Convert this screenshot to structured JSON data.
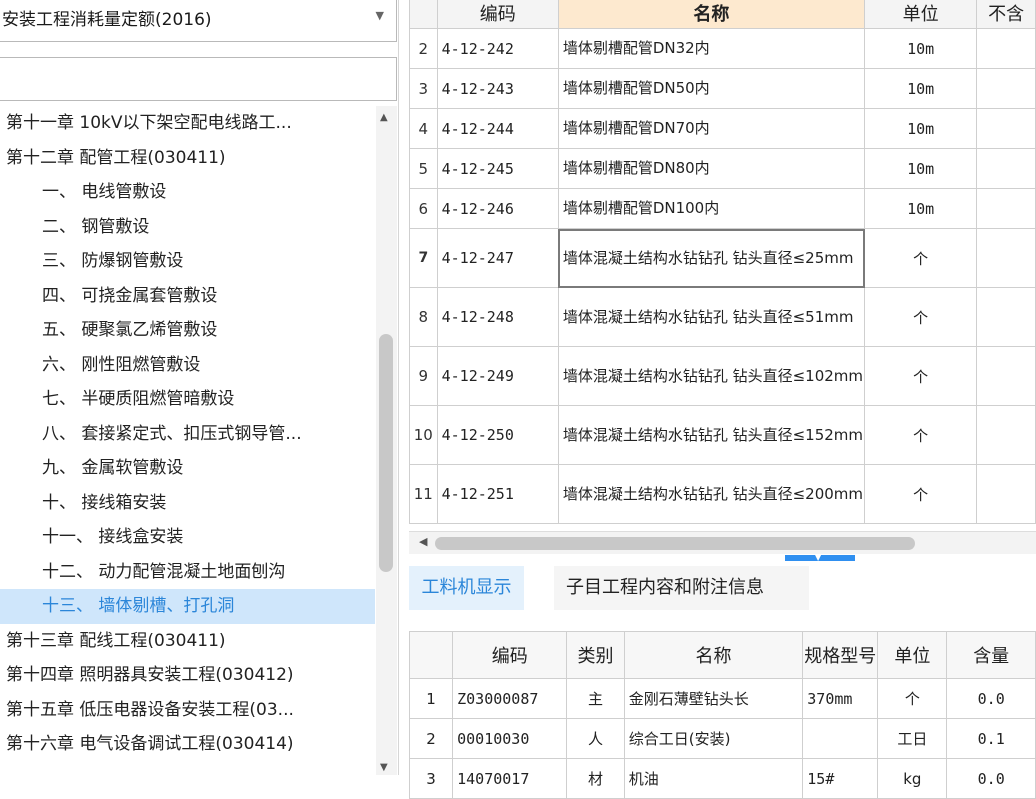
{
  "quota_library": {
    "selected": "安装工程消耗量定额(2016)"
  },
  "search": {
    "value": ""
  },
  "tree": {
    "items": [
      {
        "label": "第十一章 10kV以下架空配电线路工...",
        "level": 0,
        "selected": false
      },
      {
        "label": "第十二章 配管工程(030411)",
        "level": 0,
        "selected": false
      },
      {
        "label": "一、 电线管敷设",
        "level": 1,
        "selected": false
      },
      {
        "label": "二、 钢管敷设",
        "level": 1,
        "selected": false
      },
      {
        "label": "三、 防爆钢管敷设",
        "level": 1,
        "selected": false
      },
      {
        "label": "四、 可挠金属套管敷设",
        "level": 1,
        "selected": false
      },
      {
        "label": "五、 硬聚氯乙烯管敷设",
        "level": 1,
        "selected": false
      },
      {
        "label": "六、 刚性阻燃管敷设",
        "level": 1,
        "selected": false
      },
      {
        "label": "七、 半硬质阻燃管暗敷设",
        "level": 1,
        "selected": false
      },
      {
        "label": "八、 套接紧定式、扣压式钢导管...",
        "level": 1,
        "selected": false
      },
      {
        "label": "九、 金属软管敷设",
        "level": 1,
        "selected": false
      },
      {
        "label": "十、 接线箱安装",
        "level": 1,
        "selected": false
      },
      {
        "label": "十一、 接线盒安装",
        "level": 1,
        "selected": false
      },
      {
        "label": "十二、 动力配管混凝土地面刨沟",
        "level": 1,
        "selected": false
      },
      {
        "label": "十三、 墙体剔槽、打孔洞",
        "level": 1,
        "selected": true
      },
      {
        "label": "第十三章 配线工程(030411)",
        "level": 0,
        "selected": false
      },
      {
        "label": "第十四章 照明器具安装工程(030412)",
        "level": 0,
        "selected": false
      },
      {
        "label": "第十五章 低压电器设备安装工程(03...",
        "level": 0,
        "selected": false
      },
      {
        "label": "第十六章 电气设备调试工程(030414)",
        "level": 0,
        "selected": false
      }
    ]
  },
  "quota_grid": {
    "headers": {
      "code": "编码",
      "name": "名称",
      "unit": "单位",
      "extra": "不含"
    },
    "rows": [
      {
        "num": "2",
        "code": "4-12-242",
        "name": "墙体剔槽配管DN32内",
        "unit": "10m"
      },
      {
        "num": "3",
        "code": "4-12-243",
        "name": "墙体剔槽配管DN50内",
        "unit": "10m"
      },
      {
        "num": "4",
        "code": "4-12-244",
        "name": "墙体剔槽配管DN70内",
        "unit": "10m"
      },
      {
        "num": "5",
        "code": "4-12-245",
        "name": "墙体剔槽配管DN80内",
        "unit": "10m"
      },
      {
        "num": "6",
        "code": "4-12-246",
        "name": "墙体剔槽配管DN100内",
        "unit": "10m"
      },
      {
        "num": "7",
        "code": "4-12-247",
        "name": "墙体混凝土结构水钻钻孔 钻头直径≤25mm",
        "unit": "个"
      },
      {
        "num": "8",
        "code": "4-12-248",
        "name": "墙体混凝土结构水钻钻孔 钻头直径≤51mm",
        "unit": "个"
      },
      {
        "num": "9",
        "code": "4-12-249",
        "name": "墙体混凝土结构水钻钻孔 钻头直径≤102mm",
        "unit": "个"
      },
      {
        "num": "10",
        "code": "4-12-250",
        "name": "墙体混凝土结构水钻钻孔 钻头直径≤152mm",
        "unit": "个"
      },
      {
        "num": "11",
        "code": "4-12-251",
        "name": "墙体混凝土结构水钻钻孔 钻头直径≤200mm",
        "unit": "个"
      }
    ]
  },
  "tabs": {
    "labor_machine": "工料机显示",
    "item_content": "子目工程内容和附注信息"
  },
  "resource_grid": {
    "headers": {
      "code": "编码",
      "type": "类别",
      "name": "名称",
      "spec": "规格型号",
      "unit": "单位",
      "qty": "含量"
    },
    "rows": [
      {
        "num": "1",
        "code": "Z03000087",
        "type": "主",
        "name": "金刚石薄壁钻头长",
        "spec": "370mm",
        "unit": "个",
        "qty": "0.0"
      },
      {
        "num": "2",
        "code": "00010030",
        "type": "人",
        "name": "综合工日(安装)",
        "spec": "",
        "unit": "工日",
        "qty": "0.1"
      },
      {
        "num": "3",
        "code": "14070017",
        "type": "材",
        "name": "机油",
        "spec": "15#",
        "unit": "kg",
        "qty": "0.0"
      }
    ]
  }
}
